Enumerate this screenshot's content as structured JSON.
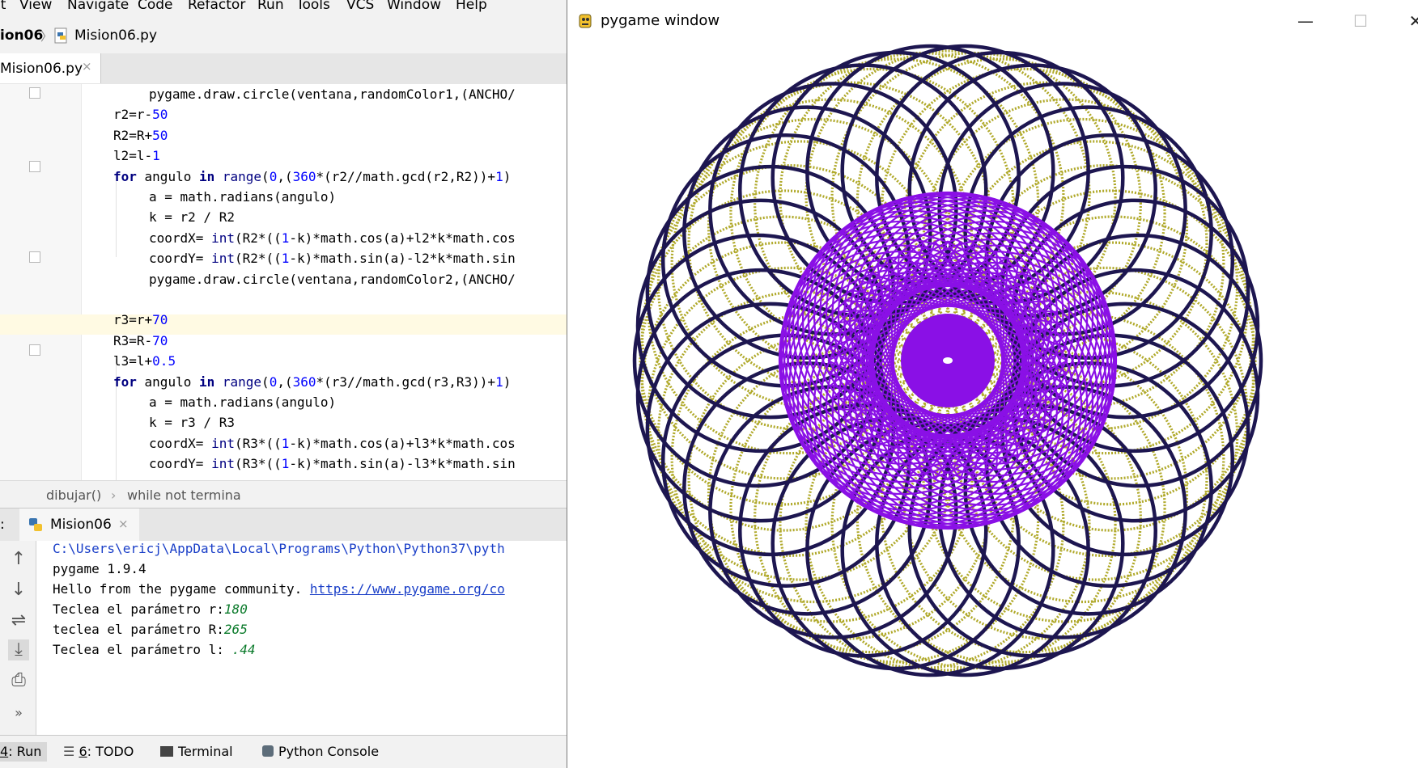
{
  "menubar": {
    "items": [
      "it",
      "View",
      "Navigate",
      "Code",
      "Refactor",
      "Run",
      "Tools",
      "VCS",
      "Window",
      "Help"
    ]
  },
  "navbar": {
    "project": "ion06",
    "file": "Mision06.py"
  },
  "editor_tab": {
    "label": "Mision06.py",
    "close": "×"
  },
  "code_lines": [
    "pygame.draw.circle(ventana,randomColor1,(ANCHO/",
    "r2=r-50",
    "R2=R+50",
    "l2=l-1",
    "for angulo in range(0,(360*(r2//math.gcd(r2,R2))+1)",
    "a = math.radians(angulo)",
    "k = r2 / R2",
    "coordX= int(R2*((1-k)*math.cos(a)+l2*k*math.cos",
    "coordY= int(R2*((1-k)*math.sin(a)-l2*k*math.sin",
    "pygame.draw.circle(ventana,randomColor2,(ANCHO/",
    "",
    "r3=r+70",
    "R3=R-70",
    "l3=l+0.5",
    "for angulo in range(0,(360*(r3//math.gcd(r3,R3))+1)",
    "a = math.radians(angulo)",
    "k = r3 / R3",
    "coordX= int(R3*((1-k)*math.cos(a)+l3*k*math.cos",
    "coordY= int(R3*((1-k)*math.sin(a)-l3*k*math.sin"
  ],
  "breadcrumbs": {
    "fn": "dibujar()",
    "sep": "›",
    "loop": "while not termina"
  },
  "run_panel": {
    "prefix": ":",
    "tab_label": "Mision06",
    "close": "×",
    "console": {
      "path": "C:\\Users\\ericj\\AppData\\Local\\Programs\\Python\\Python37\\pyth",
      "version": "pygame 1.9.4",
      "hello_prefix": "Hello from the pygame community. ",
      "hello_link": "https://www.pygame.org/co",
      "prompt_r": "Teclea el parámetro r:",
      "value_r": "180",
      "prompt_R": "teclea el parámetro R:",
      "value_R": "265",
      "prompt_l": "Teclea el parámetro l: ",
      "value_l": ".44"
    },
    "tools": [
      "up-arrow-icon",
      "down-arrow-icon",
      "soft-wrap-icon",
      "scroll-to-end-icon",
      "print-icon",
      "expand-icon"
    ]
  },
  "bottom_bar": {
    "run_num": "4",
    "run_label": ": Run",
    "todo_num": "6",
    "todo_label": ": TODO",
    "terminal": "Terminal",
    "python_console": "Python Console"
  },
  "pygame_window": {
    "title": "pygame window",
    "minimize": "—",
    "maximize": "☐",
    "close": "✕",
    "colors": {
      "outer": "#1d1650",
      "middle": "#b0a92a",
      "inner": "#8a10e6"
    }
  }
}
